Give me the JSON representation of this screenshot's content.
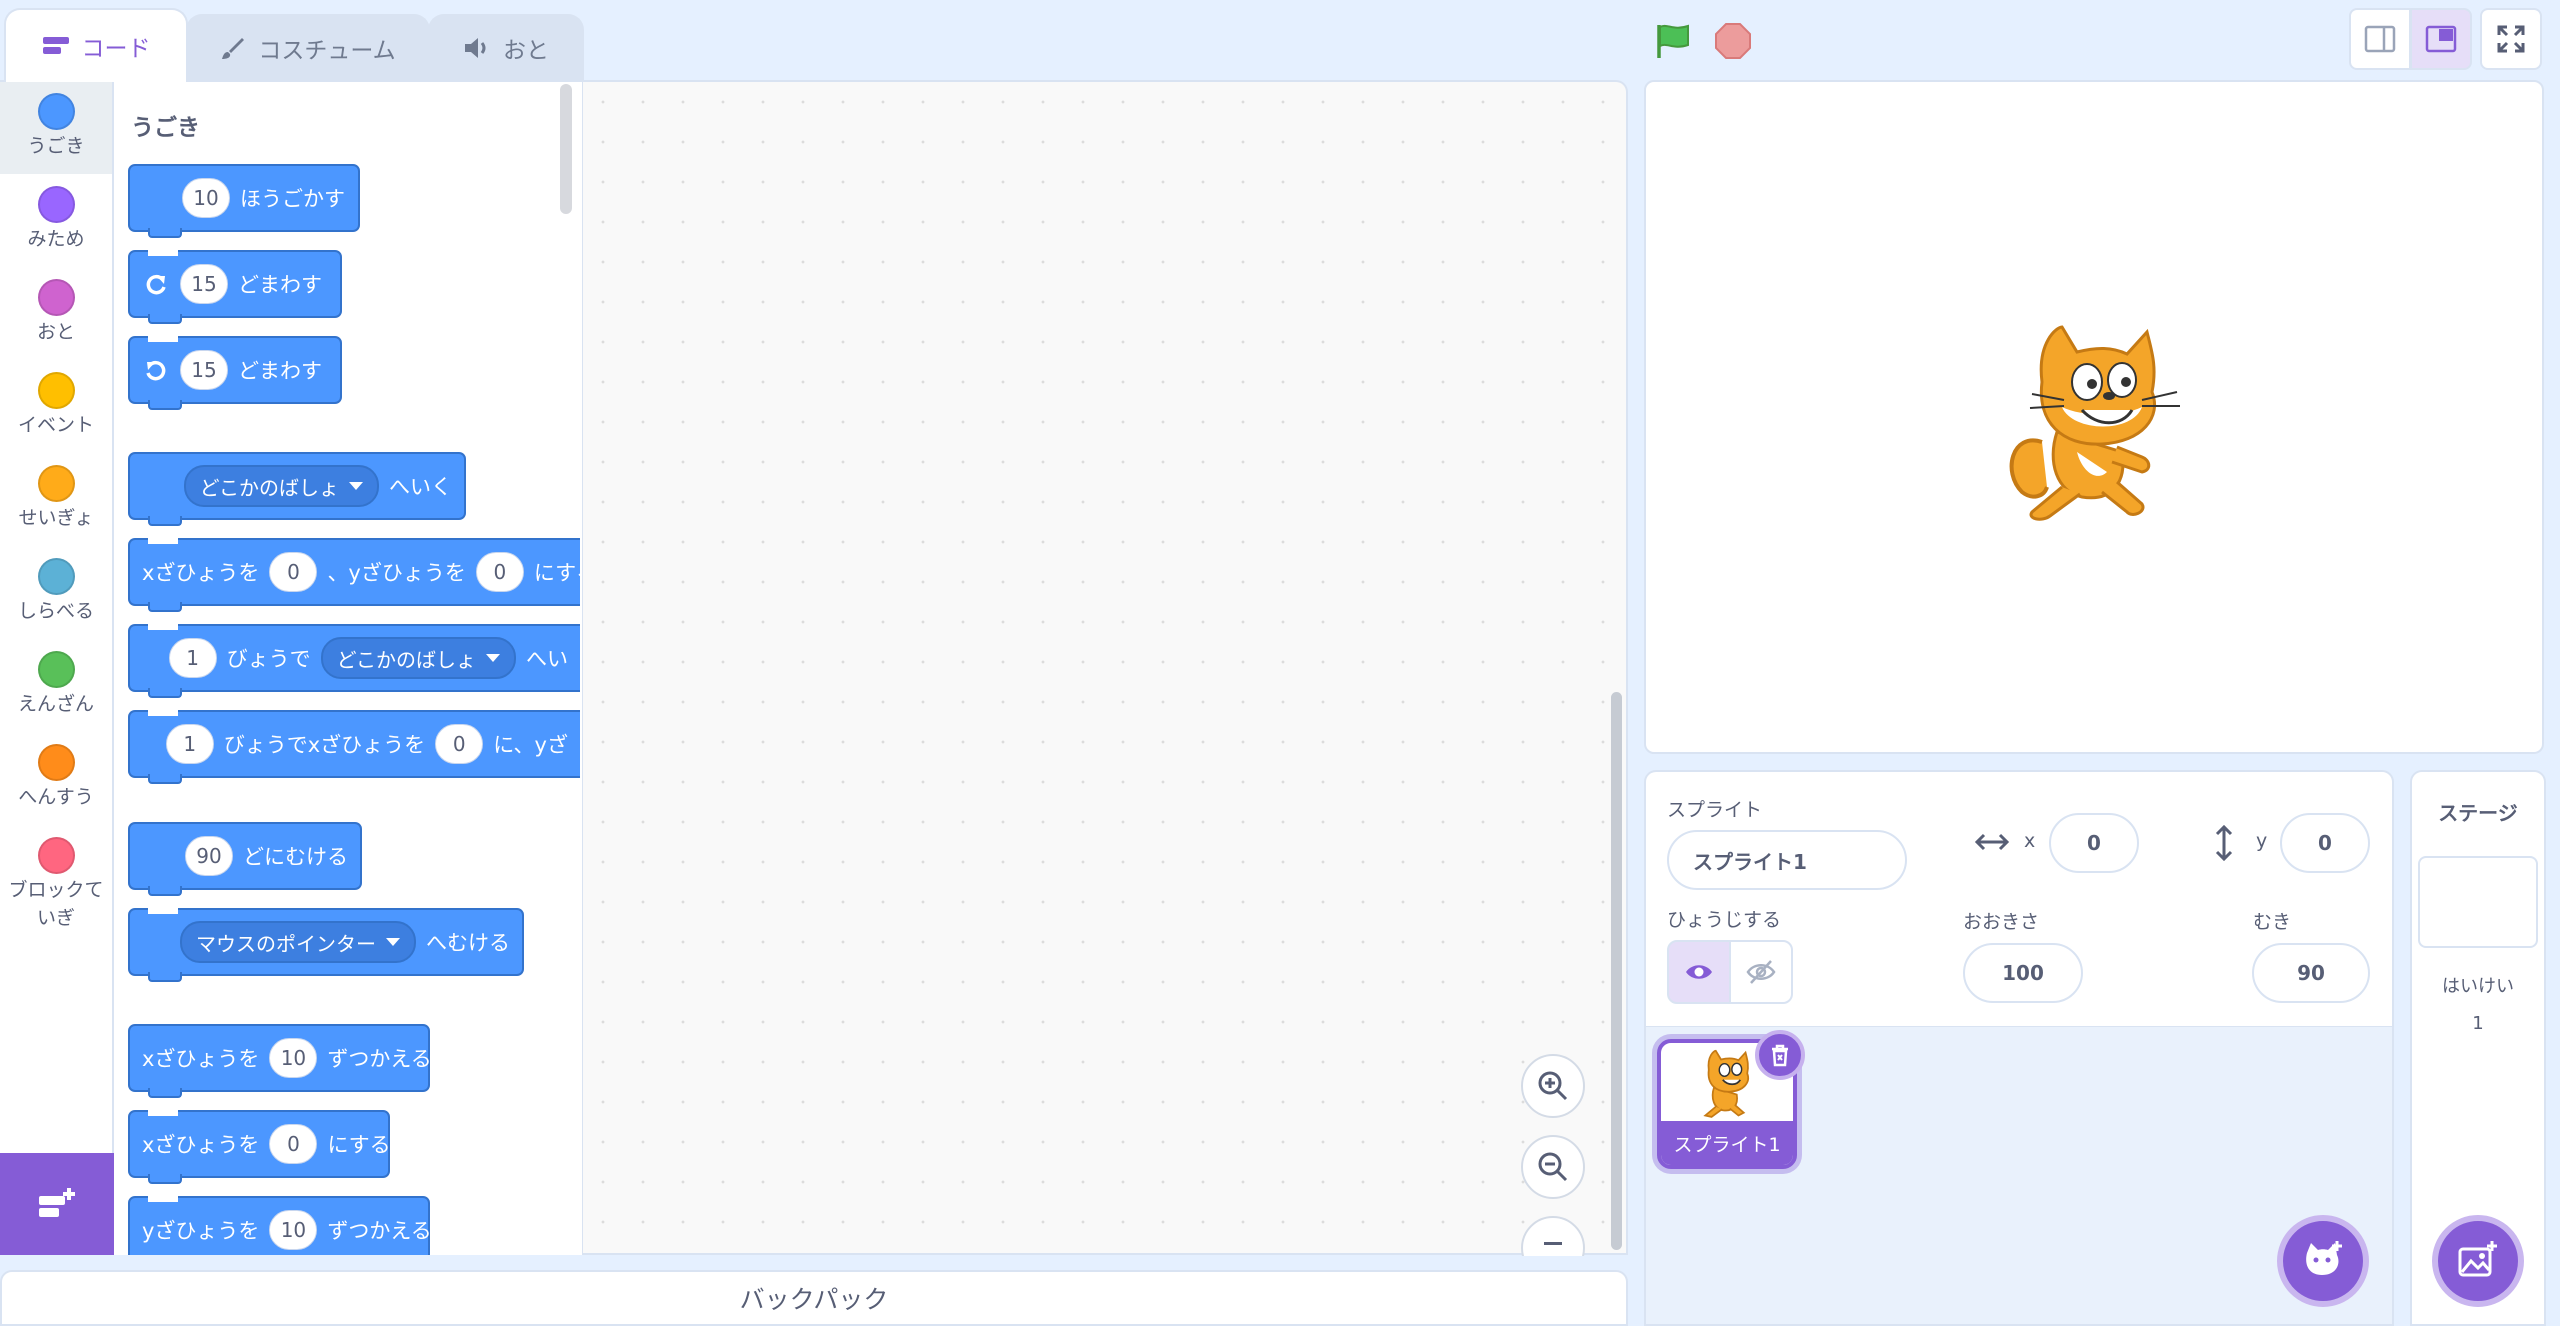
{
  "tabs": [
    {
      "label": "コード",
      "icon": "code-icon",
      "active": true
    },
    {
      "label": "コスチューム",
      "icon": "brush-icon",
      "active": false
    },
    {
      "label": "おと",
      "icon": "speaker-icon",
      "active": false
    }
  ],
  "categories": [
    {
      "label": "うごき",
      "color": "#4c97ff",
      "selected": true
    },
    {
      "label": "みため",
      "color": "#9966ff"
    },
    {
      "label": "おと",
      "color": "#cf63cf"
    },
    {
      "label": "イベント",
      "color": "#ffbf00"
    },
    {
      "label": "せいぎょ",
      "color": "#ffab19"
    },
    {
      "label": "しらべる",
      "color": "#5cb1d6"
    },
    {
      "label": "えんざん",
      "color": "#59c059"
    },
    {
      "label": "へんすう",
      "color": "#ff8c1a"
    },
    {
      "label": "ブロックていぎ",
      "color": "#ff6680"
    }
  ],
  "palette": {
    "heading": "うごき",
    "blocks": {
      "move": {
        "value": "10",
        "text": "ほうごかす"
      },
      "turn_right": {
        "icon": "rotate-right-icon",
        "value": "15",
        "text": "どまわす"
      },
      "turn_left": {
        "icon": "rotate-left-icon",
        "value": "15",
        "text": "どまわす"
      },
      "goto": {
        "menu": "どこかのばしょ",
        "text": "へいく"
      },
      "goto_xy": {
        "t1": "xざひょうを",
        "x": "0",
        "t2": "、yざひょうを",
        "y": "0",
        "t3": "にする"
      },
      "glide": {
        "value": "1",
        "t1": "びょうで",
        "menu": "どこかのばしょ",
        "t2": "へい"
      },
      "glide_xy": {
        "value": "1",
        "t1": "びょうでxざひょうを",
        "x": "0",
        "t2": "に、yざ"
      },
      "point_dir": {
        "value": "90",
        "text": "どにむける"
      },
      "point_towards": {
        "menu": "マウスのポインター",
        "text": "へむける"
      },
      "change_x": {
        "t1": "xざひょうを",
        "value": "10",
        "t2": "ずつかえる"
      },
      "set_x": {
        "t1": "xざひょうを",
        "value": "0",
        "t2": "にする"
      },
      "change_y": {
        "t1": "yざひょうを",
        "value": "10",
        "t2": "ずつかえる"
      }
    }
  },
  "backpack_label": "バックパック",
  "controls": {
    "green_flag": "green-flag-icon",
    "stop": "stop-icon"
  },
  "sprite_info": {
    "sprite_label": "スプライト",
    "sprite_name": "スプライト1",
    "x_label": "x",
    "x_value": "0",
    "y_label": "y",
    "y_value": "0",
    "show_label": "ひょうじする",
    "size_label": "おおきさ",
    "size_value": "100",
    "direction_label": "むき",
    "direction_value": "90"
  },
  "sprites": [
    {
      "name": "スプライト1",
      "selected": true
    }
  ],
  "stage_pane": {
    "title": "ステージ",
    "backdrops_label": "はいけい",
    "backdrops_count": "1"
  },
  "colors": {
    "accent": "#855cd6",
    "motion": "#4c97ff",
    "motion_border": "#3373cc",
    "background": "#e5f0ff"
  }
}
